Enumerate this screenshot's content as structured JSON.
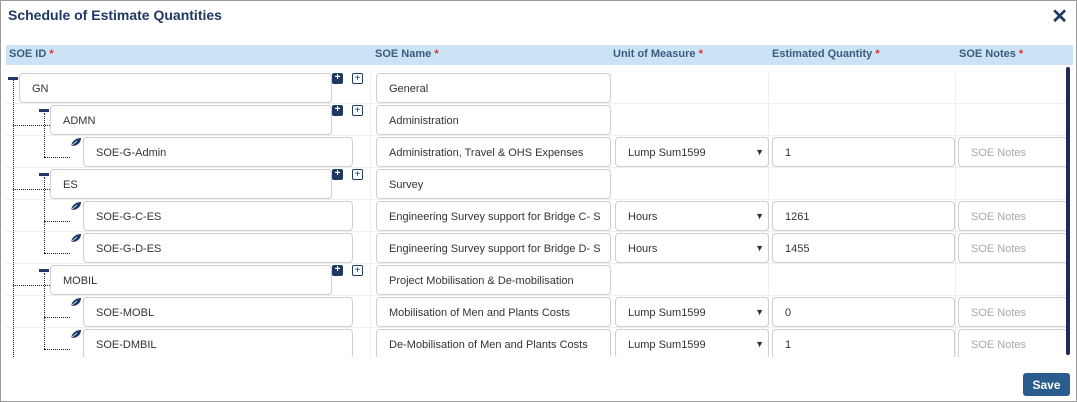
{
  "dialog": {
    "title": "Schedule of Estimate Quantities",
    "close_label": "✕",
    "save_label": "Save"
  },
  "columns": {
    "soe_id": "SOE ID",
    "soe_name": "SOE Name",
    "unit": "Unit of Measure",
    "qty": "Estimated Quantity",
    "notes": "SOE Notes",
    "required_mark": "*"
  },
  "notes_placeholder": "SOE Notes",
  "rows": [
    {
      "id": "GN",
      "name": "General",
      "type": "group"
    },
    {
      "id": "ADMN",
      "name": "Administration",
      "type": "group"
    },
    {
      "id": "SOE-G-Admin",
      "name": "Administration, Travel  & OHS Expenses",
      "type": "leaf",
      "unit": "Lump Sum1599",
      "qty": "1",
      "notes": ""
    },
    {
      "id": "ES",
      "name": "Survey",
      "type": "group"
    },
    {
      "id": "SOE-G-C-ES",
      "name": "Engineering  Survey support for Bridge C- S",
      "type": "leaf",
      "unit": "Hours",
      "qty": "1261",
      "notes": ""
    },
    {
      "id": "SOE-G-D-ES",
      "name": "Engineering  Survey support for Bridge D- S",
      "type": "leaf",
      "unit": "Hours",
      "qty": "1455",
      "notes": ""
    },
    {
      "id": "MOBIL",
      "name": "Project Mobilisation & De-mobilisation",
      "type": "group"
    },
    {
      "id": "SOE-MOBL",
      "name": "Mobilisation of Men and Plants  Costs",
      "type": "leaf",
      "unit": "Lump Sum1599",
      "qty": "0",
      "notes": ""
    },
    {
      "id": "SOE-DMBIL",
      "name": "De-Mobilisation of Men and Plants  Costs",
      "type": "leaf",
      "unit": "Lump Sum1599",
      "qty": "1",
      "notes": ""
    }
  ],
  "icons": {
    "collapse": "minus-icon",
    "add": "plus-square-icon",
    "expand": "expand-square-icon",
    "leaf": "leaf-icon",
    "dropdown": "caret-down-icon"
  },
  "colors": {
    "accent": "#1f3864",
    "header_bg": "#cce3f5",
    "save_bg": "#2a5d8e",
    "required": "#e0302f"
  }
}
